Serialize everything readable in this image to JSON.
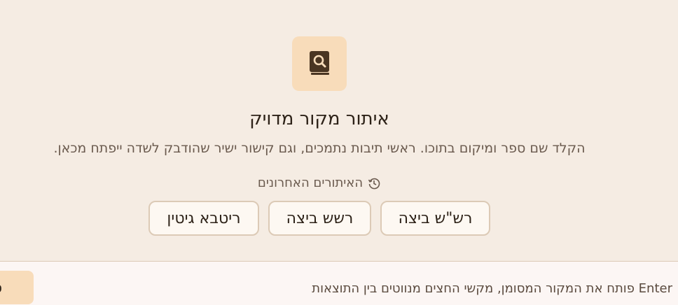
{
  "main": {
    "icon": "book-search-icon",
    "title": "איתור מקור מדויק",
    "subtitle": "הקלד שם ספר ומיקום בתוכו. ראשי תיבות נתמכים, וגם קישור ישיר שהודבק לשדה ייפתח מכאן.",
    "recent": {
      "icon": "history-icon",
      "label": "האיתורים האחרונים",
      "items": [
        {
          "label": "רש\"ש ביצה"
        },
        {
          "label": "רשש ביצה"
        },
        {
          "label": "ריטבא גיטין"
        }
      ]
    }
  },
  "footer": {
    "hint": "Enter פותח את המקור המסומן, מקשי החצים מנווטים בין התוצאות",
    "button_label": "ס"
  },
  "colors": {
    "background": "#f5ece3",
    "accent": "#f8dcba",
    "icon": "#4a3522",
    "chip_border": "#dccab6"
  }
}
